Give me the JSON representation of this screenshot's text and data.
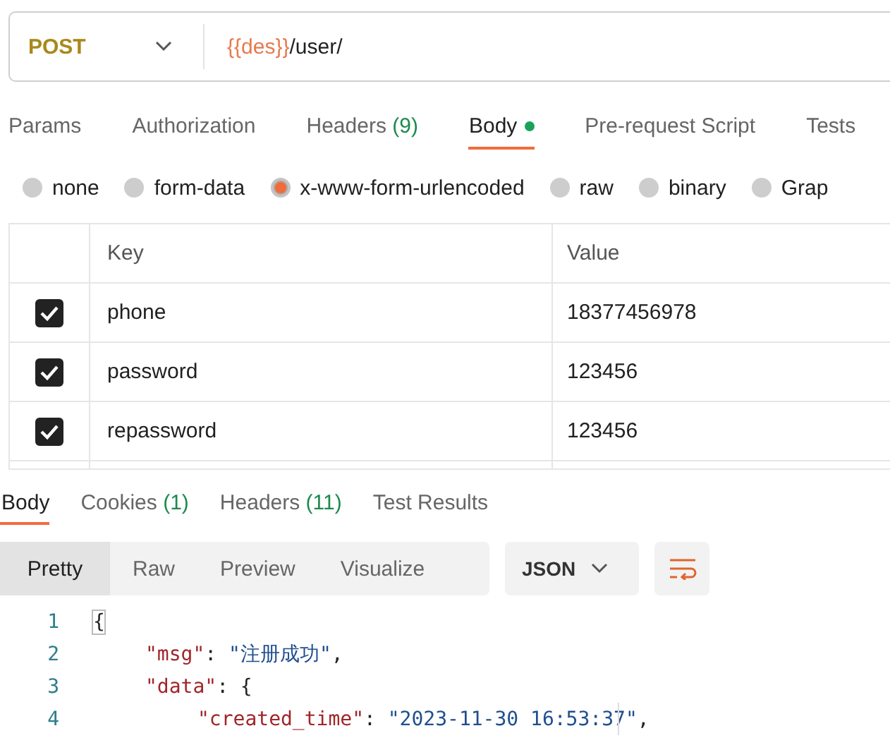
{
  "request": {
    "method": "POST",
    "url_variable": "{{des}}",
    "url_path": "/user/"
  },
  "request_tabs": [
    {
      "label": "Params",
      "selected": false
    },
    {
      "label": "Authorization",
      "selected": false
    },
    {
      "label": "Headers",
      "count": "(9)",
      "selected": false
    },
    {
      "label": "Body",
      "selected": true,
      "has_content": true
    },
    {
      "label": "Pre-request Script",
      "selected": false
    },
    {
      "label": "Tests",
      "selected": false
    }
  ],
  "body_types": [
    {
      "label": "none",
      "selected": false
    },
    {
      "label": "form-data",
      "selected": false
    },
    {
      "label": "x-www-form-urlencoded",
      "selected": true
    },
    {
      "label": "raw",
      "selected": false
    },
    {
      "label": "binary",
      "selected": false
    },
    {
      "label": "Grap",
      "selected": false
    }
  ],
  "params_table": {
    "columns": [
      "Key",
      "Value"
    ],
    "rows": [
      {
        "checked": true,
        "key": "phone",
        "value": "18377456978"
      },
      {
        "checked": true,
        "key": "password",
        "value": "123456"
      },
      {
        "checked": true,
        "key": "repassword",
        "value": "123456"
      }
    ]
  },
  "response_tabs": [
    {
      "label": "Body",
      "selected": true
    },
    {
      "label": "Cookies",
      "count": "(1)",
      "selected": false
    },
    {
      "label": "Headers",
      "count": "(11)",
      "selected": false
    },
    {
      "label": "Test Results",
      "selected": false
    }
  ],
  "view_modes": [
    {
      "label": "Pretty",
      "selected": true
    },
    {
      "label": "Raw",
      "selected": false
    },
    {
      "label": "Preview",
      "selected": false
    },
    {
      "label": "Visualize",
      "selected": false
    }
  ],
  "format_dropdown": "JSON",
  "code_lines": [
    {
      "number": "1",
      "tokens": [
        {
          "kind": "brace",
          "text": "{"
        }
      ],
      "children": [
        {
          "number": "2",
          "tokens": [
            {
              "kind": "key",
              "text": "\"msg\""
            },
            {
              "kind": "punct",
              "text": ": "
            },
            {
              "kind": "string",
              "text": "\"注册成功\""
            },
            {
              "kind": "punct",
              "text": ","
            }
          ]
        },
        {
          "number": "3",
          "tokens": [
            {
              "kind": "key",
              "text": "\"data\""
            },
            {
              "kind": "punct",
              "text": ": {"
            }
          ],
          "children": [
            {
              "number": "4",
              "tokens": [
                {
                  "kind": "key",
                  "text": "\"created_time\""
                },
                {
                  "kind": "punct",
                  "text": ": "
                },
                {
                  "kind": "string",
                  "text": "\"2023-11-30 16:53:37\""
                },
                {
                  "kind": "punct",
                  "text": ","
                }
              ]
            }
          ]
        }
      ]
    }
  ]
}
